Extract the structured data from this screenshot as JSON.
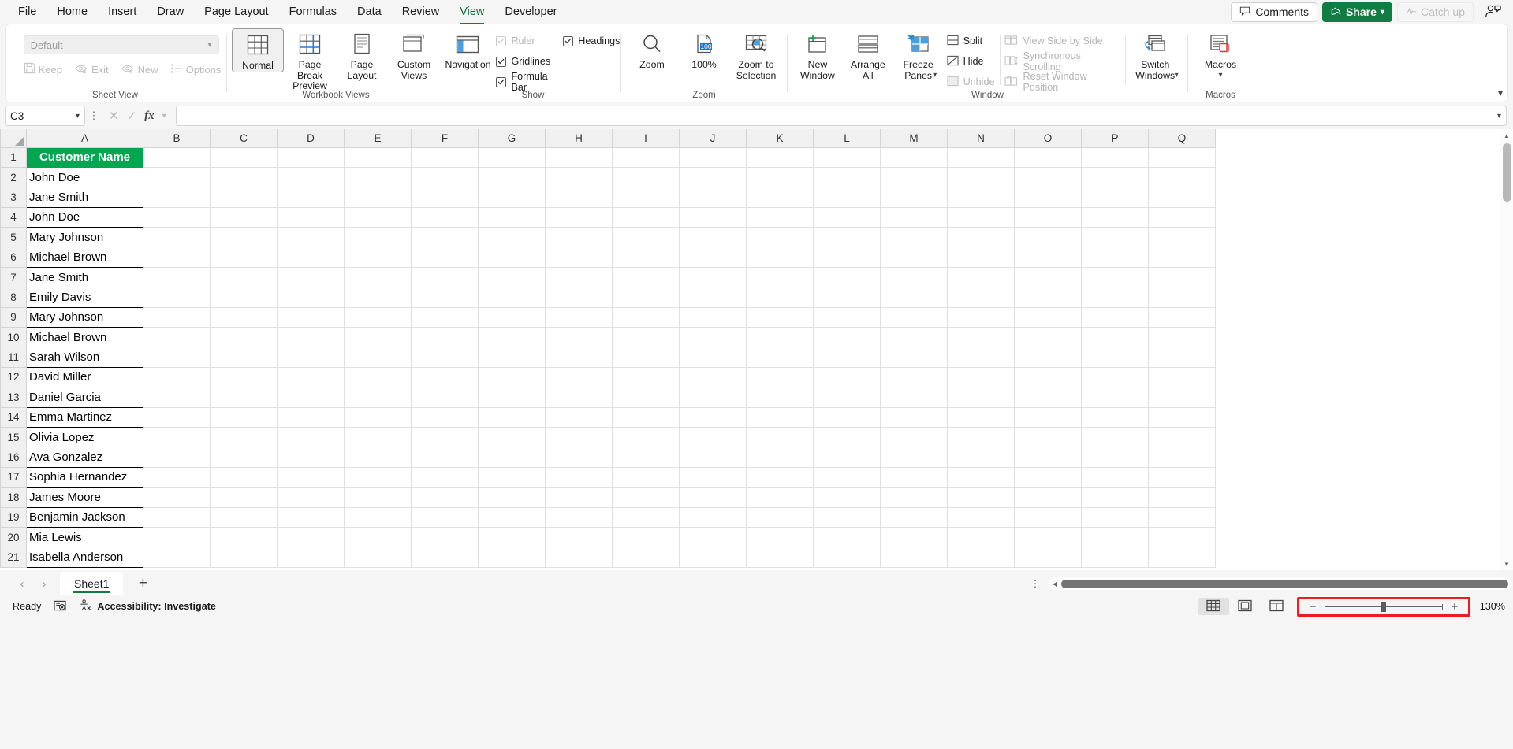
{
  "ribbon_tabs": [
    {
      "label": "File",
      "active": false
    },
    {
      "label": "Home",
      "active": false
    },
    {
      "label": "Insert",
      "active": false
    },
    {
      "label": "Draw",
      "active": false
    },
    {
      "label": "Page Layout",
      "active": false
    },
    {
      "label": "Formulas",
      "active": false
    },
    {
      "label": "Data",
      "active": false
    },
    {
      "label": "Review",
      "active": false
    },
    {
      "label": "View",
      "active": true
    },
    {
      "label": "Developer",
      "active": false
    }
  ],
  "titlebar": {
    "comments_label": "Comments",
    "share_label": "Share",
    "catchup_label": "Catch up"
  },
  "ribbon": {
    "sheet_view": {
      "group_label": "Sheet View",
      "dropdown_value": "Default",
      "keep_label": "Keep",
      "exit_label": "Exit",
      "new_label": "New",
      "options_label": "Options"
    },
    "workbook_views": {
      "group_label": "Workbook Views",
      "normal_label": "Normal",
      "page_break_label": "Page Break Preview",
      "page_layout_label": "Page Layout",
      "custom_views_label": "Custom Views"
    },
    "show": {
      "group_label": "Show",
      "navigation_label": "Navigation",
      "ruler_label": "Ruler",
      "gridlines_label": "Gridlines",
      "formula_bar_label": "Formula Bar",
      "headings_label": "Headings",
      "ruler_checked": true,
      "ruler_disabled": true,
      "gridlines_checked": true,
      "formula_bar_checked": true,
      "headings_checked": true
    },
    "zoom": {
      "group_label": "Zoom",
      "zoom_label": "Zoom",
      "hundred_label": "100%",
      "hundred_badge": "100",
      "zoom_to_selection_label": "Zoom to Selection"
    },
    "window": {
      "group_label": "Window",
      "new_window_label": "New Window",
      "arrange_all_label": "Arrange All",
      "freeze_panes_label": "Freeze Panes",
      "split_label": "Split",
      "hide_label": "Hide",
      "unhide_label": "Unhide",
      "view_side_by_side_label": "View Side by Side",
      "synchronous_scrolling_label": "Synchronous Scrolling",
      "reset_window_position_label": "Reset Window Position",
      "switch_windows_label": "Switch Windows"
    },
    "macros": {
      "group_label": "Macros",
      "macros_label": "Macros"
    }
  },
  "formula_bar": {
    "name_box_value": "C3",
    "formula_value": ""
  },
  "grid": {
    "columns": [
      "A",
      "B",
      "C",
      "D",
      "E",
      "F",
      "G",
      "H",
      "I",
      "J",
      "K",
      "L",
      "M",
      "N",
      "O",
      "P",
      "Q"
    ],
    "rows": [
      1,
      2,
      3,
      4,
      5,
      6,
      7,
      8,
      9,
      10,
      11,
      12,
      13,
      14,
      15,
      16,
      17,
      18,
      19,
      20,
      21
    ],
    "header_cell": "Customer Name",
    "header_bg": "#00a650",
    "column_a_values": [
      "John Doe",
      "Jane Smith",
      "John Doe",
      "Mary Johnson",
      "Michael Brown",
      "Jane Smith",
      "Emily Davis",
      "Mary Johnson",
      "Michael Brown",
      "Sarah Wilson",
      "David Miller",
      "Daniel Garcia",
      "Emma Martinez",
      "Olivia Lopez",
      "Ava Gonzalez",
      "Sophia Hernandez",
      "James Moore",
      "Benjamin Jackson",
      "Mia Lewis",
      "Isabella Anderson"
    ]
  },
  "sheet_tabs": {
    "tabs": [
      "Sheet1"
    ],
    "active": "Sheet1"
  },
  "status_bar": {
    "ready_label": "Ready",
    "accessibility_label": "Accessibility: Investigate",
    "zoom_percent": "130%"
  }
}
